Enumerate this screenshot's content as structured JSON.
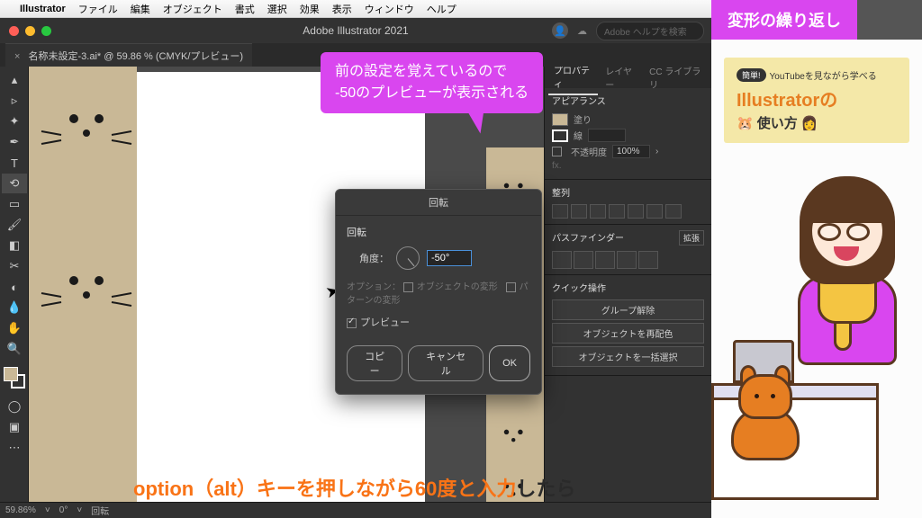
{
  "mac_menu": {
    "app": "Illustrator",
    "items": [
      "ファイル",
      "編集",
      "オブジェクト",
      "書式",
      "選択",
      "効果",
      "表示",
      "ウィンドウ",
      "ヘルプ"
    ]
  },
  "window": {
    "title": "Adobe Illustrator 2021",
    "search_placeholder": "Adobe ヘルプを検索",
    "doc_tab": "名称未設定-3.ai* @ 59.86 % (CMYK/プレビュー)"
  },
  "panels": {
    "tabs": [
      "プロパティ",
      "レイヤー",
      "CC ライブラリ"
    ],
    "appearance": {
      "heading": "アピアランス",
      "fill": "塗り",
      "stroke": "線",
      "stroke_weight": "",
      "opacity_label": "不透明度",
      "opacity_value": "100%",
      "fx": "fx."
    },
    "align": {
      "heading": "整列"
    },
    "pathfinder": {
      "heading": "パスファインダー",
      "expand": "拡張"
    },
    "quick": {
      "heading": "クイック操作",
      "buttons": [
        "グループ解除",
        "オブジェクトを再配色",
        "オブジェクトを一括選択"
      ]
    }
  },
  "dialog": {
    "title": "回転",
    "section": "回転",
    "angle_label": "角度：",
    "angle_value": "-50°",
    "options_label": "オプション：",
    "opt_transform": "オブジェクトの変形",
    "opt_pattern": "パターンの変形",
    "preview": "プレビュー",
    "copy": "コピー",
    "cancel": "キャンセル",
    "ok": "OK"
  },
  "status": {
    "zoom": "59.86%",
    "rotate": "0°",
    "tool": "回転"
  },
  "annotation": {
    "line1": "前の設定を覚えているので",
    "line2": "-50のプレビューが表示される"
  },
  "subtitle": {
    "orange": "option（alt）キーを押しながら60度と入力",
    "dark": "したら"
  },
  "tutorial": {
    "header": "変形の繰り返し",
    "badge": "簡単!",
    "top_text": "YouTubeを見ながら学べる",
    "title": "Illustratorの",
    "sub": "使い方"
  }
}
